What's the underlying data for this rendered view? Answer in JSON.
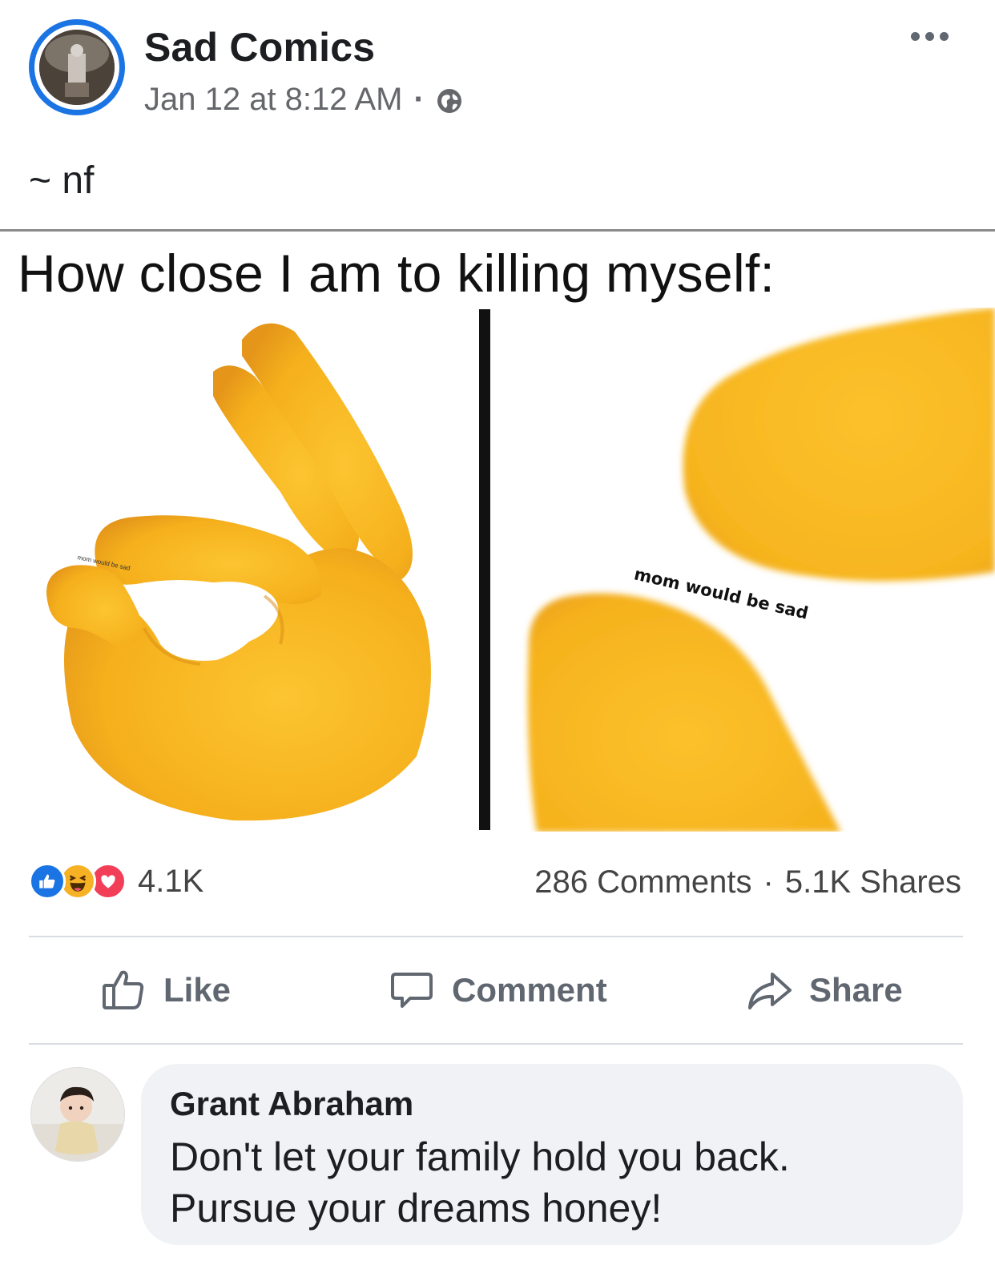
{
  "post": {
    "page_name": "Sad Comics",
    "timestamp": "Jan 12 at 8:12 AM",
    "separator": "·",
    "privacy_icon": "globe-icon",
    "more_icon": "more-options-icon",
    "caption": "~ nf"
  },
  "meme": {
    "title": "How close I am to killing myself:",
    "left_panel_tiny_text": "mom would be sad",
    "right_panel_text": "mom would be sad",
    "colors": {
      "hand": "#f7b51f",
      "hand_shade": "#e9961a",
      "divider": "#111111"
    }
  },
  "stats": {
    "reaction_icons": [
      "like-reaction-icon",
      "haha-reaction-icon",
      "love-reaction-icon"
    ],
    "reaction_count": "4.1K",
    "comments": "286 Comments",
    "separator": "·",
    "shares": "5.1K Shares"
  },
  "actions": {
    "like_label": "Like",
    "comment_label": "Comment",
    "share_label": "Share"
  },
  "comment": {
    "author": "Grant Abraham",
    "line1": "Don't let your family hold you back.",
    "line2": "Pursue your dreams honey!"
  },
  "colors": {
    "brand_blue": "#1b74e4",
    "secondary_text": "#65676b",
    "bubble_bg": "#f0f2f5",
    "haha": "#f7b125",
    "love": "#f33e58"
  }
}
